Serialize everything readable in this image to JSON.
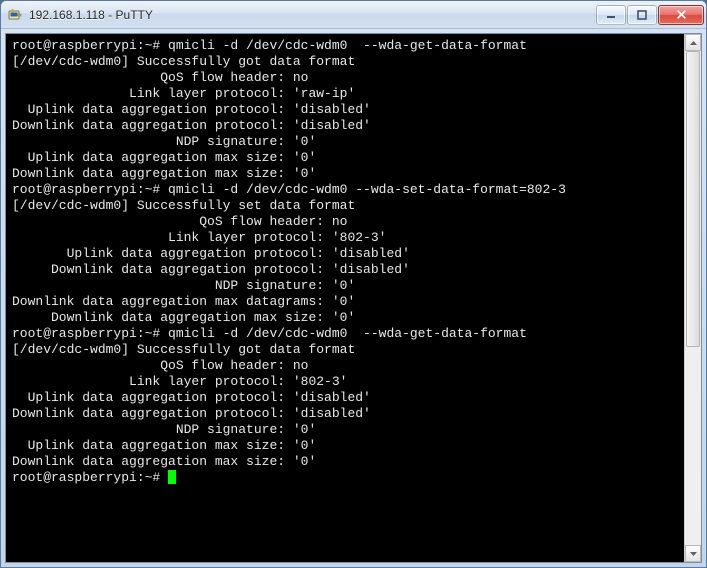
{
  "window": {
    "title": "192.168.1.118 - PuTTY"
  },
  "terminal": {
    "lines": [
      "root@raspberrypi:~# qmicli -d /dev/cdc-wdm0  --wda-get-data-format",
      "[/dev/cdc-wdm0] Successfully got data format",
      "                   QoS flow header: no",
      "               Link layer protocol: 'raw-ip'",
      "  Uplink data aggregation protocol: 'disabled'",
      "Downlink data aggregation protocol: 'disabled'",
      "                     NDP signature: '0'",
      "  Uplink data aggregation max size: '0'",
      "Downlink data aggregation max size: '0'",
      "root@raspberrypi:~# qmicli -d /dev/cdc-wdm0 --wda-set-data-format=802-3",
      "[/dev/cdc-wdm0] Successfully set data format",
      "                        QoS flow header: no",
      "                    Link layer protocol: '802-3'",
      "       Uplink data aggregation protocol: 'disabled'",
      "     Downlink data aggregation protocol: 'disabled'",
      "                          NDP signature: '0'",
      "Downlink data aggregation max datagrams: '0'",
      "     Downlink data aggregation max size: '0'",
      "root@raspberrypi:~# qmicli -d /dev/cdc-wdm0  --wda-get-data-format",
      "[/dev/cdc-wdm0] Successfully got data format",
      "                   QoS flow header: no",
      "               Link layer protocol: '802-3'",
      "  Uplink data aggregation protocol: 'disabled'",
      "Downlink data aggregation protocol: 'disabled'",
      "                     NDP signature: '0'",
      "  Uplink data aggregation max size: '0'",
      "Downlink data aggregation max size: '0'",
      "root@raspberrypi:~# "
    ]
  }
}
